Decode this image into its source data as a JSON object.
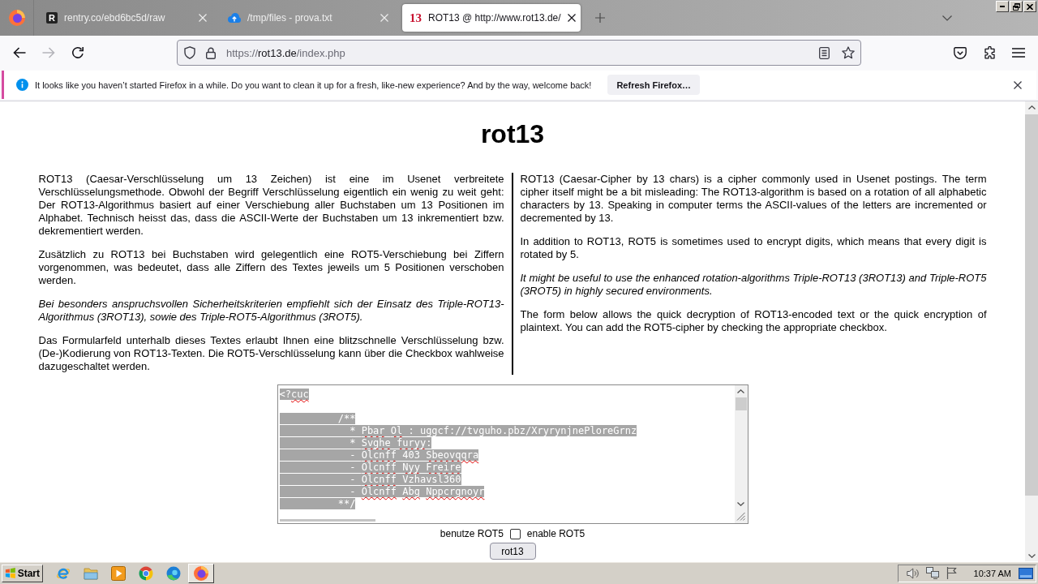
{
  "browser": {
    "tabs": [
      {
        "title": "rentry.co/ebd6bc5d/raw",
        "selected": false,
        "favicon": {
          "kind": "letter",
          "text": "R"
        }
      },
      {
        "title": "/tmp/files - prova.txt",
        "selected": false,
        "favicon": {
          "kind": "cloud"
        }
      },
      {
        "title": "ROT13 @ http://www.rot13.de/",
        "selected": true,
        "favicon": {
          "kind": "number",
          "text": "13"
        }
      }
    ],
    "navigation": [
      {
        "kind": "back",
        "disabled": false
      },
      {
        "kind": "forward",
        "disabled": true
      },
      {
        "kind": "reload",
        "disabled": false
      }
    ],
    "address_bar": {
      "scheme": "https://",
      "host": "rot13.de",
      "path": "/index.php"
    },
    "notification": {
      "message": "It looks like you haven’t started Firefox in a while. Do you want to clean it up for a fresh, like-new experience? And by the way, welcome back!",
      "button": "Refresh Firefox…"
    }
  },
  "page": {
    "title": "rot13",
    "columns": [
      {
        "paragraphs": [
          {
            "text": "ROT13 (Caesar-Verschlüsselung um 13 Zeichen) ist eine im Usenet verbreitete Verschlüsselungsmethode. Obwohl der Begriff Verschlüsselung eigentlich ein wenig zu weit geht: Der ROT13-Algorithmus basiert auf einer Verschiebung aller Buchstaben um 13 Positionen im Alphabet. Technisch heisst das, dass die ASCII-Werte der Buchstaben um 13 inkrementiert bzw. dekrementiert werden.",
            "italic": false
          },
          {
            "text": "Zusätzlich zu ROT13 bei Buchstaben wird gelegentlich eine ROT5-Verschiebung bei Ziffern vorgenommen, was bedeutet, dass alle Ziffern des Textes jeweils um 5 Positionen verschoben werden.",
            "italic": false
          },
          {
            "text": "Bei besonders anspruchsvollen Sicherheitskriterien empfiehlt sich der Einsatz des Triple-ROT13-Algorithmus (3ROT13), sowie des Triple-ROT5-Algorithmus (3ROT5).",
            "italic": true
          },
          {
            "text": "Das Formularfeld unterhalb dieses Textes erlaubt Ihnen eine blitzschnelle Verschlüsselung bzw. (De-)Kodierung von ROT13-Texten. Die ROT5-Verschlüsselung kann über die Checkbox wahlweise dazugeschaltet werden.",
            "italic": false
          }
        ]
      },
      {
        "paragraphs": [
          {
            "text": "ROT13 (Caesar-Cipher by 13 chars) is a cipher commonly used in Usenet postings. The term cipher itself might be a bit misleading: The ROT13-algorithm is based on a rotation of all alphabetic characters by 13. Speaking in computer terms the ASCII-values of the letters are incremented or decremented by 13.",
            "italic": false
          },
          {
            "text": "In addition to ROT13, ROT5 is sometimes used to encrypt digits, which means that every digit is rotated by 5.",
            "italic": false
          },
          {
            "text": "It might be useful to use the enhanced rotation-algorithms Triple-ROT13 (3ROT13) and Triple-ROT5 (3ROT5) in highly secured environments.",
            "italic": true
          },
          {
            "text": "The form below allows the quick decryption of ROT13-encoded text or the quick encryption of plaintext. You can add the ROT5-cipher by checking the appropriate checkbox.",
            "italic": false
          }
        ]
      }
    ],
    "form": {
      "text_selected": true,
      "text": [
        {
          "text": "<?",
          "misspelled": false
        },
        {
          "text": "cuc",
          "misspelled": true
        },
        {
          "text": "\n\n          /**\n            * ",
          "misspelled": false
        },
        {
          "text": "Pbar ",
          "misspelled": true
        },
        {
          "text": "Ol",
          "misspelled": true
        },
        {
          "text": " : uggcf://tvguho.pbz/XryrynjnePloreGrnz\n            * ",
          "misspelled": false
        },
        {
          "text": "Svghe ",
          "misspelled": true
        },
        {
          "text": "furyy",
          "misspelled": true
        },
        {
          "text": ":\n            - ",
          "misspelled": false
        },
        {
          "text": "Olcnff",
          "misspelled": true
        },
        {
          "text": " 403 ",
          "misspelled": false
        },
        {
          "text": "Sbeovqqra",
          "misspelled": true
        },
        {
          "text": "\n            - ",
          "misspelled": false
        },
        {
          "text": "Olcnff ",
          "misspelled": true
        },
        {
          "text": "Nyy ",
          "misspelled": true
        },
        {
          "text": "Freire",
          "misspelled": true
        },
        {
          "text": "\n            - ",
          "misspelled": false
        },
        {
          "text": "Olcnff",
          "misspelled": true
        },
        {
          "text": " Vzhavsl360\n            - ",
          "misspelled": false
        },
        {
          "text": "Olcnff ",
          "misspelled": true
        },
        {
          "text": "Abg ",
          "misspelled": true
        },
        {
          "text": "Nppcrgnoyr",
          "misspelled": true
        },
        {
          "text": "\n          **/",
          "misspelled": false
        }
      ],
      "checkbox": {
        "label_before": "benutze ROT5",
        "label_after": "enable ROT5",
        "checked": false
      },
      "button": "rot13"
    }
  },
  "taskbar": {
    "start": "Start",
    "apps": [
      {
        "kind": "ie",
        "active": false
      },
      {
        "kind": "explorer",
        "active": false
      },
      {
        "kind": "media",
        "active": false
      },
      {
        "kind": "chrome",
        "active": false
      },
      {
        "kind": "edge",
        "active": false
      },
      {
        "kind": "firefox",
        "active": true
      }
    ],
    "clock": "10:37 AM"
  }
}
